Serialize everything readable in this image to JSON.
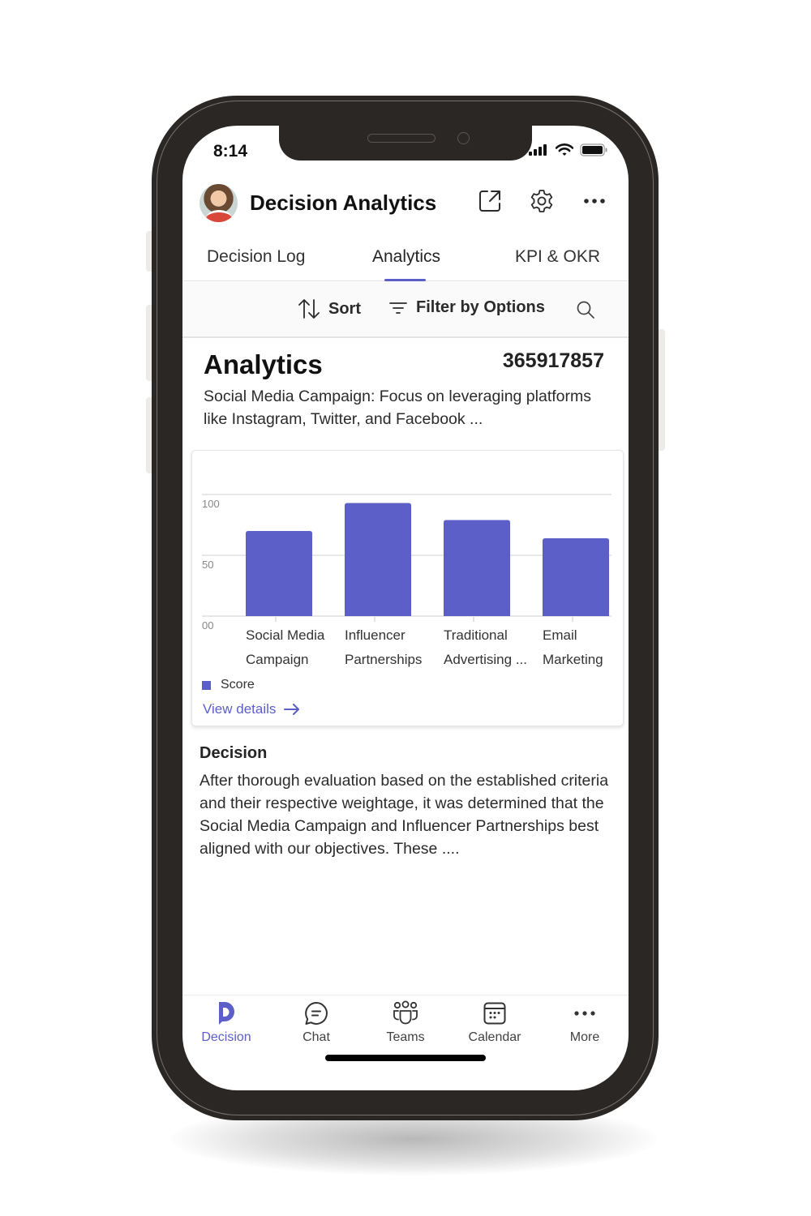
{
  "status_bar": {
    "time": "8:14",
    "icons": [
      "signal-icon",
      "wifi-icon",
      "battery-icon"
    ]
  },
  "header": {
    "title": "Decision Analytics",
    "icons": [
      "open-external-icon",
      "gear-icon",
      "more-horizontal-icon"
    ]
  },
  "tabs": [
    {
      "label": "Decision Log",
      "active": false
    },
    {
      "label": "Analytics",
      "active": true
    },
    {
      "label": "KPI & OKR",
      "active": false
    }
  ],
  "toolbar": {
    "sort_label": "Sort",
    "filter_label": "Filter by Options",
    "search_icon": "search-icon"
  },
  "section": {
    "title": "Analytics",
    "record_id": "365917857",
    "summary": "Social Media Campaign: Focus on leveraging platforms like Instagram, Twitter, and Facebook ..."
  },
  "chart_data": {
    "type": "bar",
    "title": "",
    "xlabel": "",
    "ylabel": "",
    "categories": [
      [
        "Social Media",
        "Campaign"
      ],
      [
        "Influencer",
        "Partnerships"
      ],
      [
        "Traditional",
        "Advertising ..."
      ],
      [
        "Email",
        "Marketing"
      ]
    ],
    "series": [
      {
        "name": "Score",
        "values": [
          70,
          93,
          79,
          64
        ],
        "color": "#5b5fc7"
      }
    ],
    "ylim": [
      0,
      100
    ],
    "y_ticks": [
      {
        "value": 100,
        "label": "100"
      },
      {
        "value": 50,
        "label": "50"
      },
      {
        "value": 0,
        "label": "00"
      }
    ],
    "grid": true,
    "legend": "bottom-left"
  },
  "card": {
    "view_details_label": "View details"
  },
  "decision": {
    "label": "Decision",
    "text": "After thorough evaluation based on the established criteria and their respective weightage, it was determined that the Social Media Campaign and Influencer Partnerships best aligned with our objectives. These ...."
  },
  "bottom_nav": [
    {
      "label": "Decision",
      "icon": "decision-logo-icon",
      "active": true
    },
    {
      "label": "Chat",
      "icon": "chat-icon",
      "active": false
    },
    {
      "label": "Teams",
      "icon": "teams-icon",
      "active": false
    },
    {
      "label": "Calendar",
      "icon": "calendar-icon",
      "active": false
    },
    {
      "label": "More",
      "icon": "more-horizontal-icon",
      "active": false
    }
  ],
  "colors": {
    "accent": "#5b5fc7",
    "frame": "#2b2725"
  }
}
